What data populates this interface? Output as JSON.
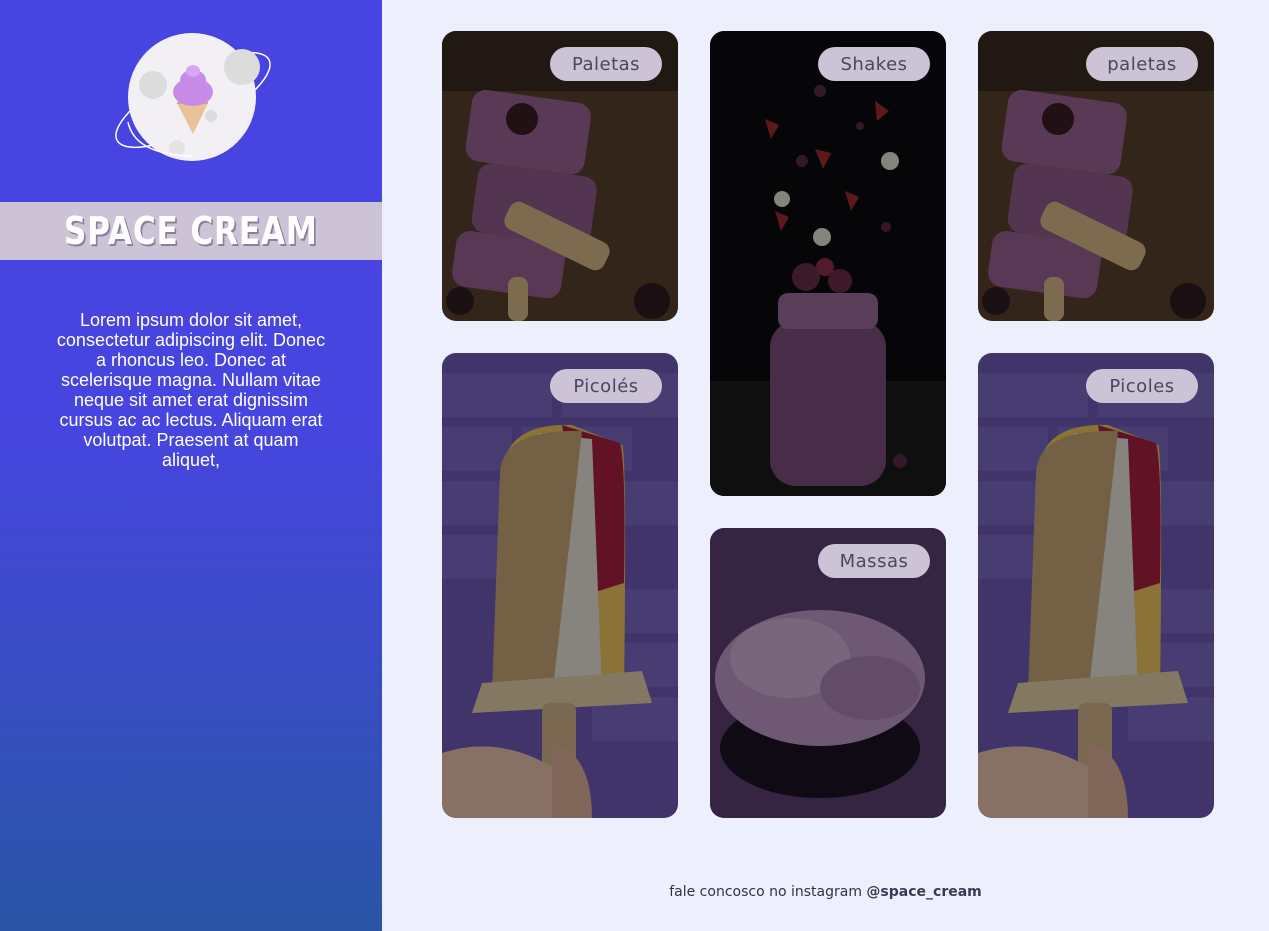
{
  "brand": {
    "title": "Space Cream",
    "intro": "Lorem ipsum dolor sit amet, consectetur adipiscing elit. Donec a rhoncus leo. Donec at scelerisque magna. Nullam vitae neque sit amet erat dignissim cursus ac ac lectus. Aliquam erat volutpat. Praesent at quam aliquet,"
  },
  "cards": [
    {
      "label": "Paletas",
      "image": "popsicle-bars-image"
    },
    {
      "label": "Shakes",
      "image": "berry-shake-image"
    },
    {
      "label": "paletas",
      "image": "popsicle-bars-image"
    },
    {
      "label": "Picolés",
      "image": "dipped-popsicle-image"
    },
    {
      "label": "Massas",
      "image": "ice-cream-scoop-image"
    },
    {
      "label": "Picoles",
      "image": "dipped-popsicle-image"
    }
  ],
  "footer": {
    "text": "fale concosco no instagram",
    "handle": "@space_cream"
  },
  "colors": {
    "sidebar_top": "#4844e2",
    "sidebar_bottom": "#2a55a6",
    "band": "#cdc3d7",
    "page_bg": "#eeeffc"
  }
}
